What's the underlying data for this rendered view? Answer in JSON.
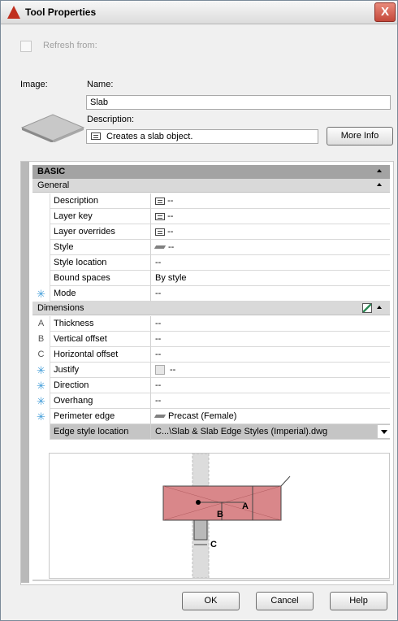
{
  "window": {
    "title": "Tool Properties",
    "close_glyph": "X"
  },
  "refresh": {
    "label": "Refresh from:",
    "checked": false
  },
  "image_label": "Image:",
  "name": {
    "label": "Name:",
    "value": "Slab"
  },
  "description": {
    "label": "Description:",
    "value": "Creates a slab object."
  },
  "more_info_label": "More Info",
  "sections": {
    "basic": "BASIC",
    "general": "General",
    "dimensions": "Dimensions"
  },
  "general_rows": [
    {
      "name": "Description",
      "value": "--"
    },
    {
      "name": "Layer key",
      "value": "--"
    },
    {
      "name": "Layer overrides",
      "value": "--"
    },
    {
      "name": "Style",
      "value": "--"
    },
    {
      "name": "Style location",
      "value": "--"
    },
    {
      "name": "Bound spaces",
      "value": "By style"
    },
    {
      "name": "Mode",
      "value": "--"
    }
  ],
  "dimension_rows": [
    {
      "marker": "A",
      "name": "Thickness",
      "value": "--"
    },
    {
      "marker": "B",
      "name": "Vertical offset",
      "value": "--"
    },
    {
      "marker": "C",
      "name": "Horizontal offset",
      "value": "--"
    },
    {
      "marker": "",
      "name": "Justify",
      "value": "--"
    },
    {
      "marker": "",
      "name": "Direction",
      "value": "--"
    },
    {
      "marker": "",
      "name": "Overhang",
      "value": "--"
    },
    {
      "marker": "",
      "name": "Perimeter edge",
      "value": "Precast (Female)"
    },
    {
      "marker": "",
      "name": "Edge style location",
      "value": "C...\\Slab & Slab Edge Styles (Imperial).dwg"
    }
  ],
  "diagram_labels": {
    "a": "A",
    "b": "B",
    "c": "C"
  },
  "buttons": {
    "ok": "OK",
    "cancel": "Cancel",
    "help": "Help"
  },
  "colors": {
    "slab_fill": "#d9878a",
    "star": "#3f9bd8",
    "close": "#c4473a"
  }
}
